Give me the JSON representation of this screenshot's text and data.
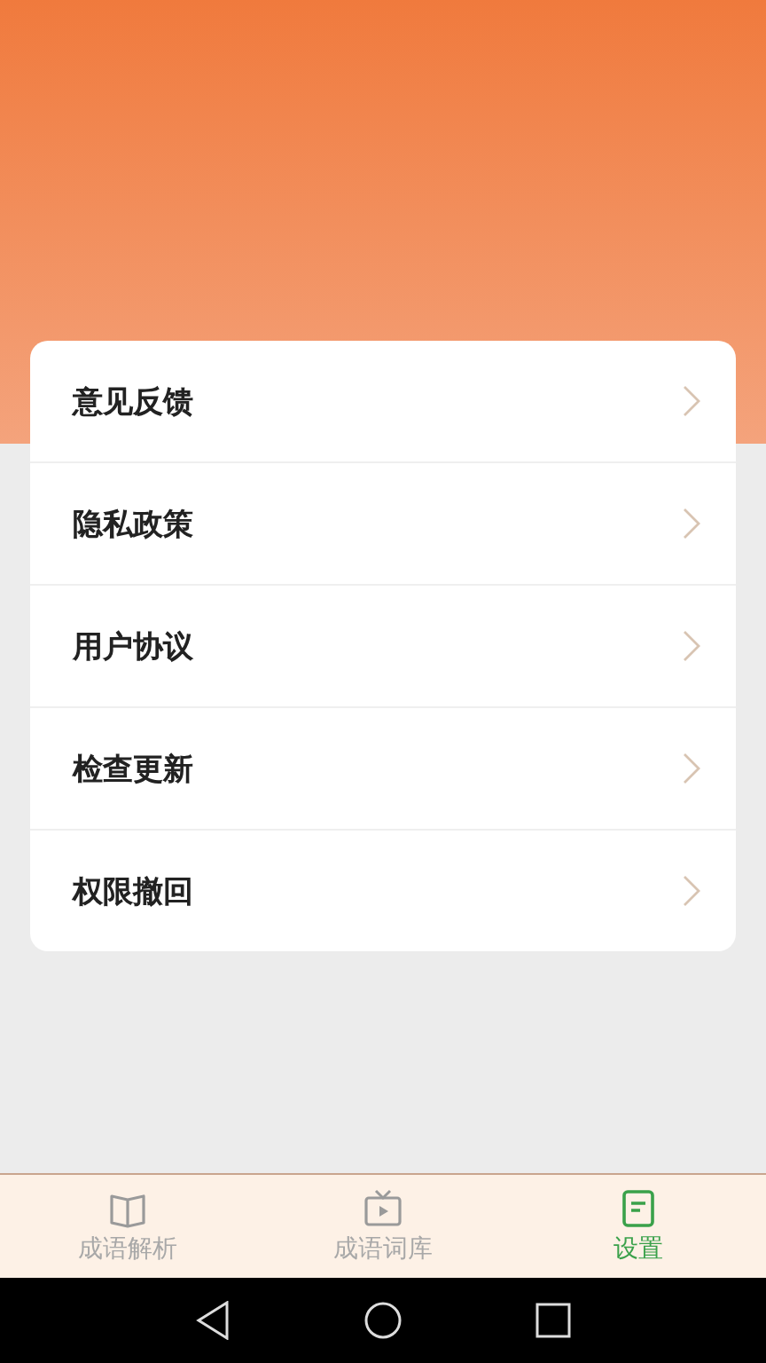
{
  "menu": [
    {
      "label": "意见反馈"
    },
    {
      "label": "隐私政策"
    },
    {
      "label": "用户协议"
    },
    {
      "label": "检查更新"
    },
    {
      "label": "权限撤回"
    }
  ],
  "tabs": [
    {
      "kind": "book",
      "label": "成语解析",
      "selected": false
    },
    {
      "kind": "tv",
      "label": "成语词库",
      "selected": false
    },
    {
      "kind": "doc",
      "label": "设置",
      "selected": true
    }
  ]
}
